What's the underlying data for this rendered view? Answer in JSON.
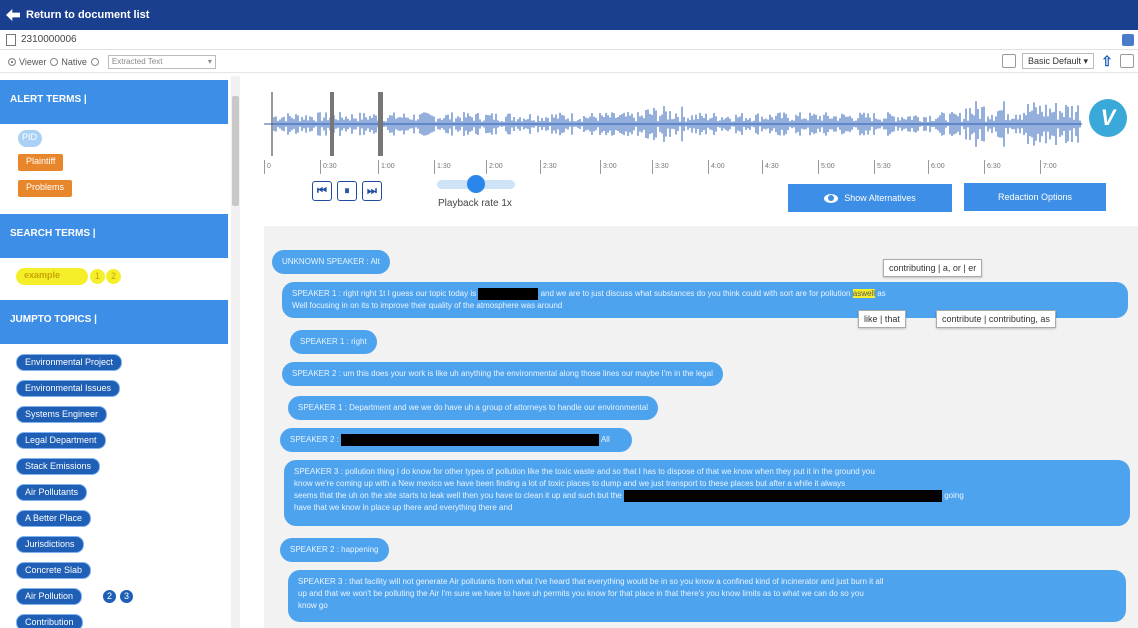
{
  "header": {
    "back_label": "Return to document list"
  },
  "document": {
    "name": "2310000006"
  },
  "view_bar": {
    "options": [
      "Viewer",
      "Native",
      "Extracted Text"
    ],
    "select_value": "Extracted Text",
    "basic_default": "Basic Default ▾"
  },
  "sidebar": {
    "alert_header": "ALERT TERMS |",
    "alert_terms": [
      "PID",
      "Plaintiff",
      "Problems"
    ],
    "search_header": "SEARCH TERMS |",
    "search_terms": [
      {
        "label": "example",
        "counts": [
          "1",
          "2"
        ]
      }
    ],
    "jump_header": "JUMPTO TOPICS |",
    "topics": [
      "Environmental Project",
      "Environmental Issues",
      "Systems Engineer",
      "Legal Department",
      "Stack Emissions",
      "Air Pollutants",
      "A Better Place",
      "Jurisdictions",
      "Concrete Slab",
      "Air Pollution",
      "Contribution"
    ],
    "topic_badges": [
      "2",
      "3"
    ]
  },
  "player": {
    "time_ticks": [
      "0",
      "0:30",
      "1:00",
      "1:30",
      "2:00",
      "2:30",
      "3:00",
      "3:30",
      "4:00",
      "4:30",
      "5:00",
      "5:30",
      "6:00",
      "6:30",
      "7:00"
    ],
    "playback_rate": "Playback rate 1x",
    "show_alternatives": "Show Alternatives",
    "redaction_options": "Redaction Options",
    "logo_letter": "V"
  },
  "transcript": {
    "lines": [
      {
        "text": "UNKNOWN SPEAKER : Alt"
      },
      {
        "before": "SPEAKER 1 : right right 1t I guess our topic today is",
        "after": "and we are to just discuss what substances do you think could with sort are for pollution",
        "hl1": "as",
        "hl2": "well",
        "tail": "as",
        "line2": "Well focusing in on its to improve their quality of the atmosphere was around"
      },
      {
        "text": "SPEAKER 1 : right"
      },
      {
        "text": "SPEAKER 2 : um this does your work is like uh anything the environmental along those lines our maybe I'm in the legal"
      },
      {
        "text": "SPEAKER 1 : Department and we we do have uh a group of attorneys to handle our environmental"
      },
      {
        "before": "SPEAKER 2 :",
        "after": "All"
      },
      {
        "line1": "SPEAKER 3 : pollution thing I do know for other types of pollution like the toxic waste and so that I has to dispose of that we know when they put it in the ground you",
        "line2": "know we're coming up with a New mexico we have been finding a lot of toxic places to dump and we just transport to these places but after a while it always",
        "line3before": "seems that the uh on the site starts to leak well then you have to clean it up and such but the",
        "line3after": "going",
        "line4": "have that we know in place up there and everything there and"
      },
      {
        "text": "SPEAKER 2 : happening"
      },
      {
        "line1": "SPEAKER 3 : that facility will not generate Air pollutants from what I've heard that everything would be in so you know a confined kind of incinerator and just burn it all",
        "line2": "up and that we won't be polluting the Air I'm sure we have to have uh permits you know for that place in that there's you know limits as to what we can do so you",
        "line3": "know go"
      }
    ],
    "tooltips": [
      "contributing | a, or | er",
      "like | that",
      "contribute | contributing, as"
    ]
  }
}
